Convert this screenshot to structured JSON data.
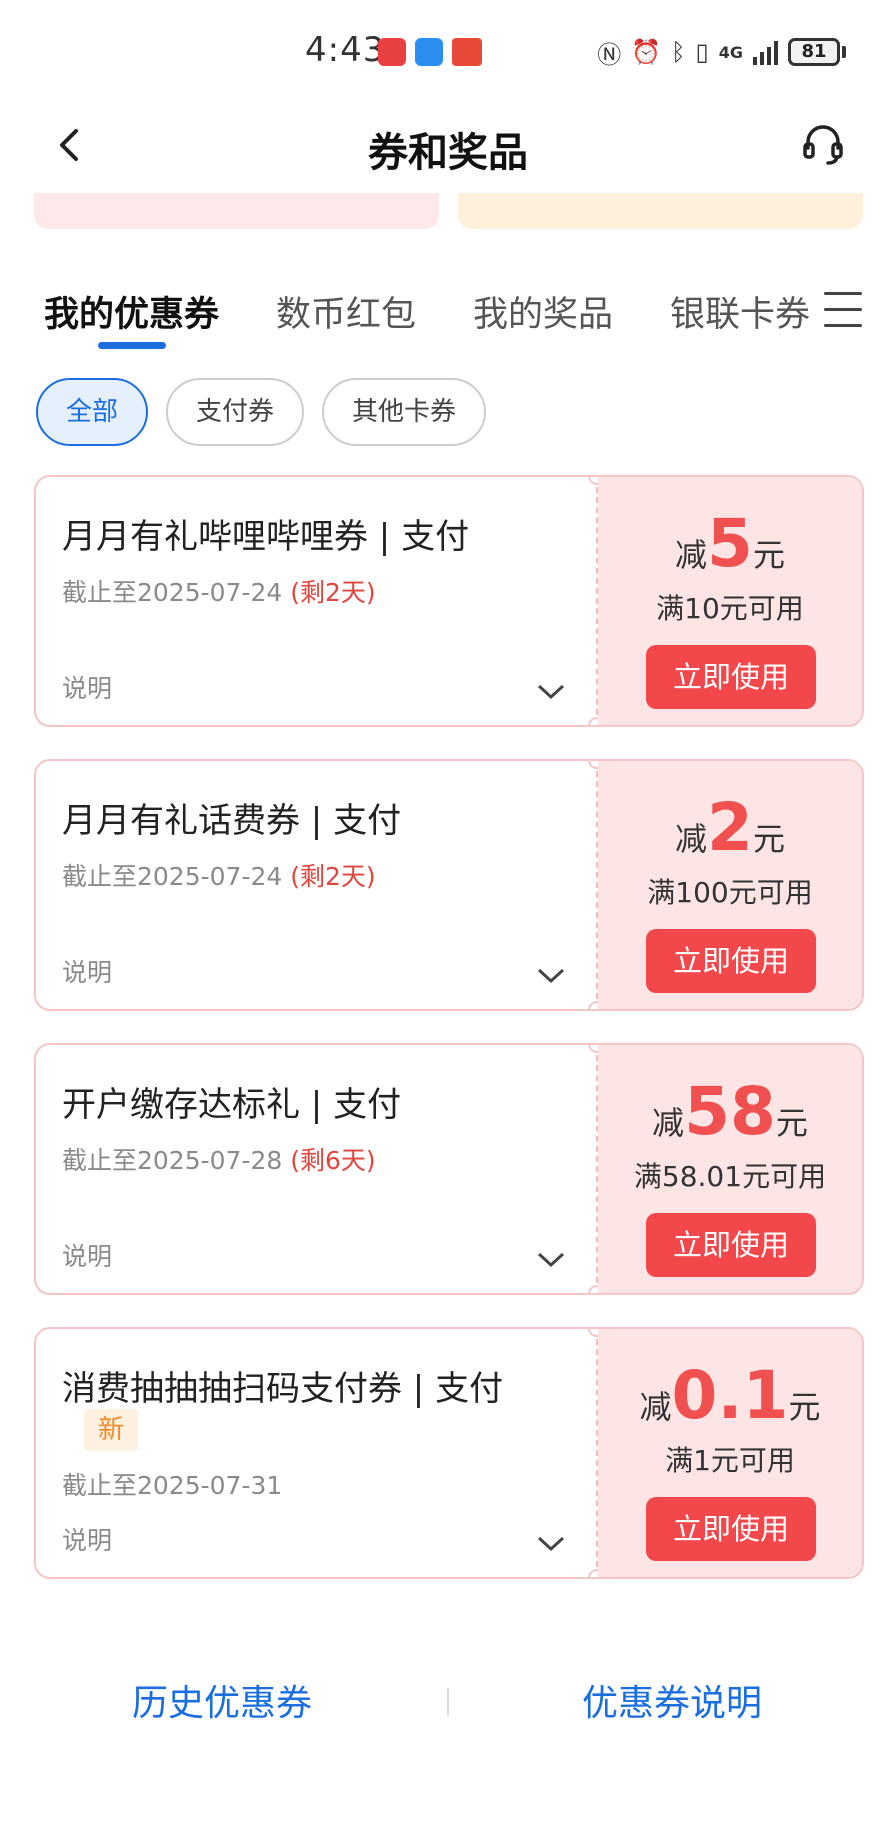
{
  "status_bar": {
    "time": "4:43",
    "network": "4G",
    "battery": "81"
  },
  "header": {
    "title": "券和奖品"
  },
  "tabs": [
    {
      "label": "我的优惠券",
      "active": true
    },
    {
      "label": "数币红包",
      "active": false
    },
    {
      "label": "我的奖品",
      "active": false
    },
    {
      "label": "银联卡券",
      "active": false
    }
  ],
  "filters": [
    {
      "label": "全部",
      "active": true
    },
    {
      "label": "支付券",
      "active": false
    },
    {
      "label": "其他卡券",
      "active": false
    }
  ],
  "coupons": [
    {
      "title": "月月有礼哔哩哔哩券 | 支付",
      "date": "截止至2025-07-24",
      "remain": "(剩2天)",
      "explain": "说明",
      "prefix": "减",
      "amount": "5",
      "unit": "元",
      "condition": "满10元可用",
      "button": "立即使用"
    },
    {
      "title": "月月有礼话费券 | 支付",
      "date": "截止至2025-07-24",
      "remain": "(剩2天)",
      "explain": "说明",
      "prefix": "减",
      "amount": "2",
      "unit": "元",
      "condition": "满100元可用",
      "button": "立即使用"
    },
    {
      "title": "开户缴存达标礼 | 支付",
      "date": "截止至2025-07-28",
      "remain": "(剩6天)",
      "explain": "说明",
      "prefix": "减",
      "amount": "58",
      "unit": "元",
      "condition": "满58.01元可用",
      "button": "立即使用"
    },
    {
      "title": "消费抽抽抽扫码支付券 | 支付",
      "badge": "新",
      "date": "截止至2025-07-31",
      "explain": "说明",
      "prefix": "减",
      "amount": "0.1",
      "unit": "元",
      "condition": "满1元可用",
      "button": "立即使用"
    }
  ],
  "footer": {
    "history": "历史优惠券",
    "explanation": "优惠券说明"
  },
  "colors": {
    "accent_blue": "#1a6ee0",
    "coupon_red": "#f05050",
    "button_red": "#f2484c",
    "coupon_right_bg": "#fde5e5"
  }
}
